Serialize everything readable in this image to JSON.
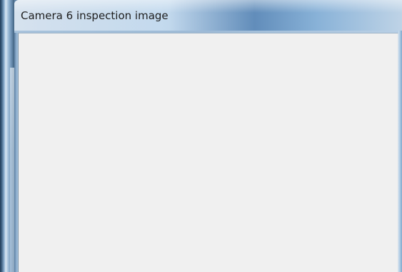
{
  "window": {
    "title": "Camera 6 inspection image"
  },
  "colors": {
    "client_background": "#f0f0f0",
    "frame_accent": "#6e92b6"
  }
}
